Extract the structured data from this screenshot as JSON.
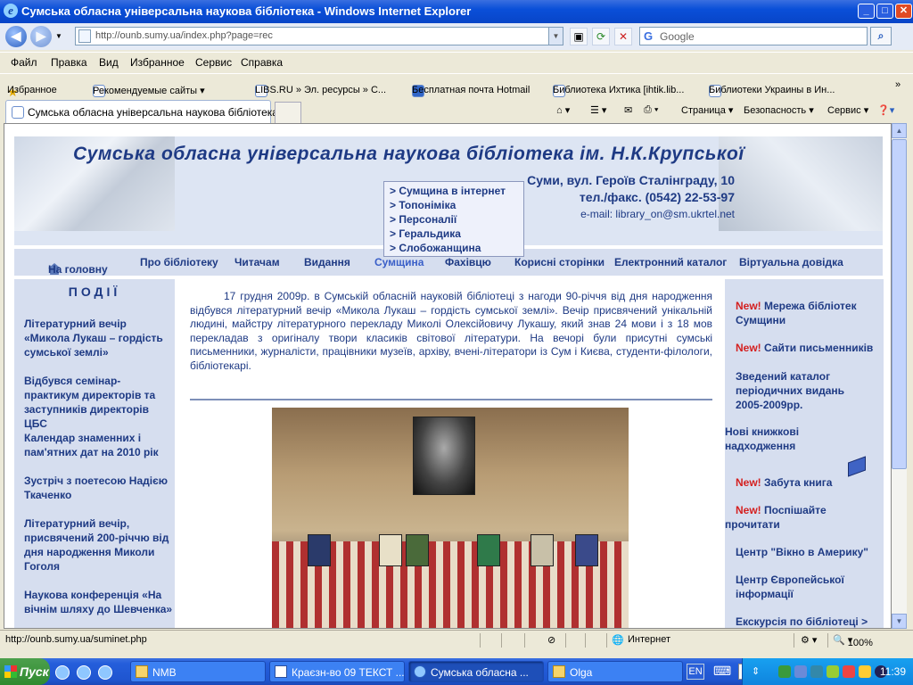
{
  "window": {
    "title": "Сумська обласна універсальна наукова бібліотека - Windows Internet Explorer",
    "min": "_",
    "max": "□",
    "close": "✕"
  },
  "address_bar": {
    "url": "http://ounb.sumy.ua/index.php?page=rec",
    "search_placeholder": "Google"
  },
  "menu": [
    "Файл",
    "Правка",
    "Вид",
    "Избранное",
    "Сервис",
    "Справка"
  ],
  "favorites_bar": {
    "favorites_label": "Избранное",
    "links": [
      "Рекомендуемые сайты ▾",
      "LIBS.RU » Эл. ресурсы » С...",
      "Бесплатная почта Hotmail",
      "Библиотека Ихтика [ihtik.lib...",
      "Библиотеки Украины в Ин..."
    ]
  },
  "tabs": {
    "active": "Сумська обласна універсальна наукова бібліотека",
    "commands": [
      "Страница ▾",
      "Безопасность ▾",
      "Сервис ▾"
    ]
  },
  "page": {
    "site_title": "Сумська обласна універсальна наукова бібліотека ім. Н.К.Крупської",
    "address_line": "Суми, вул. Героїв Сталінграду, 10",
    "phone_line": "тел./факс. (0542) 22-53-97",
    "email_line": "e-mail: library_on@sm.ukrtel.net",
    "submenu": [
      "> Сумщина в інтернет",
      "> Топоніміка",
      "> Персоналії",
      "> Геральдика",
      "> Слобожанщина"
    ],
    "nav": [
      "На головну",
      "Про бібліотеку",
      "Читачам",
      "Видання",
      "Сумщина",
      "Фахівцю",
      "Корисні сторінки",
      "Електронний каталог",
      "Віртуальна довідка"
    ],
    "events_heading": "ПОДІЇ",
    "events": [
      "Літературний вечір «Микола Лукаш – гордість сумської землі»",
      "Відбувся семінар-практикум директорів та заступників директорів ЦБС",
      "Календар знаменних і пам'ятних дат на 2010 рік",
      "Зустріч з поетесою Надією Ткаченко",
      "Літературний вечір, присвячений 200-річчю від дня народження Миколи Гоголя",
      "Наукова конференція «На вічнім шляху до Шевченка»"
    ],
    "article": "17 грудня 2009р. в Сумській обласній науковій бібліотеці з нагоди 90-річчя від дня народження відбувся літературний вечір «Микола Лукаш – гордість сумської землі». Вечір присвячений унікальній людині, майстру літературного перекладу Миколі Олексійовичу Лукашу, який знав 24 мови і з 18 мов перекладав з оригіналу твори класиків світової літератури. На вечорі були присутні сумські письменники, журналісти, працівники музеїв, архіву, вчені-літератори із Сум і Києва, студенти-філологи, бібліотекарі.",
    "right_new": "New!",
    "right_links": [
      "Мережа бібліотек Сумщини",
      "Сайти письменників",
      "Зведений каталог періодичних видань 2005-2009рр.",
      "Нові книжкові надходження",
      "Забута книга",
      "Поспішайте прочитати",
      "Центр \"Вікно в Америку\"",
      "Центр Європейської інформації",
      "Екскурсія по бібліотеці >"
    ]
  },
  "status_bar": {
    "link": "http://ounb.sumy.ua/suminet.php",
    "zone": "Интернет",
    "zoom": "100%"
  },
  "taskbar": {
    "start": "Пуск",
    "tasks": [
      "NMB",
      "Краєзн-во 09 ТЕКСТ ...",
      "Сумська обласна ...",
      "Olga"
    ],
    "lang": "EN",
    "clock": "11:39"
  }
}
